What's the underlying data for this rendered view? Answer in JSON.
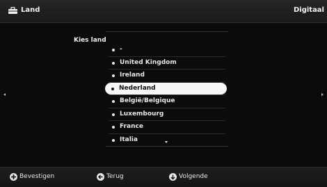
{
  "header": {
    "title": "Land",
    "source": "Digitaal",
    "icon": "suitcase-icon"
  },
  "list": {
    "label": "Kies land",
    "items": [
      {
        "label": "-"
      },
      {
        "label": "United Kingdom"
      },
      {
        "label": "Ireland"
      },
      {
        "label": "Nederland",
        "selected": true
      },
      {
        "label": "België/Belgique"
      },
      {
        "label": "Luxembourg"
      },
      {
        "label": "France"
      },
      {
        "label": "Italia"
      }
    ]
  },
  "footer": {
    "confirm_label": "Bevestigen",
    "back_label": "Terug",
    "next_label": "Volgende"
  }
}
